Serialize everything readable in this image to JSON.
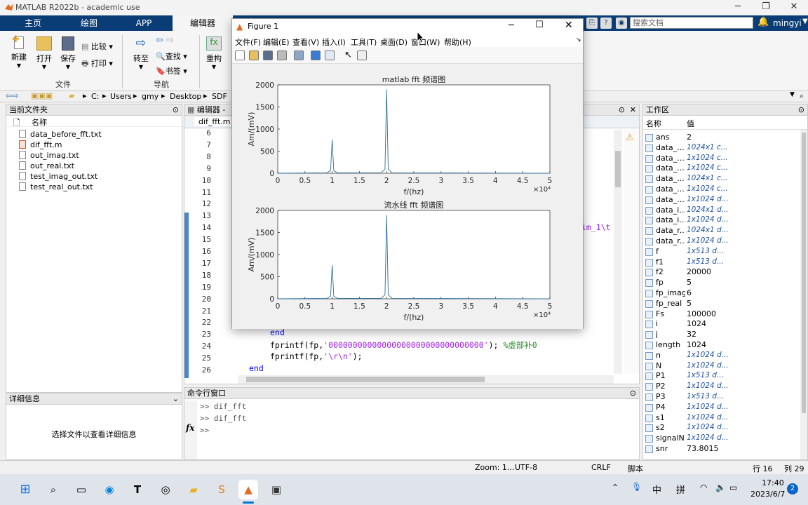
{
  "app": {
    "title": "MATLAB R2022b - academic use",
    "user": "mingyi",
    "search_placeholder": "搜索文档"
  },
  "tabs": [
    "主页",
    "绘图",
    "APP",
    "编辑器"
  ],
  "ribbon": {
    "buttons": {
      "new": "新建",
      "open": "打开",
      "save": "保存",
      "compare": "比较",
      "print": "打印",
      "goto": "转至",
      "find": "查找",
      "bookmark": "书签",
      "refactor": "重构"
    },
    "groups": {
      "file": "文件",
      "navigate": "导航"
    }
  },
  "path": [
    "C:",
    "Users",
    "gmy",
    "Desktop",
    "SDF"
  ],
  "files_panel": {
    "title": "当前文件夹",
    "col_name": "名称",
    "items": [
      "data_before_fft.txt",
      "dif_fft.m",
      "out_imag.txt",
      "out_real.txt",
      "test_imag_out.txt",
      "test_real_out.txt"
    ]
  },
  "details_panel": {
    "title": "详细信息",
    "message": "选择文件以查看详细信息"
  },
  "editor": {
    "title": "编辑器 - ",
    "tab": "dif_fft.m",
    "line_numbers": [
      "6",
      "7",
      "8",
      "9",
      "10",
      "11",
      "12",
      "13",
      "14",
      "15",
      "16",
      "17",
      "18",
      "19",
      "20",
      "21",
      "22",
      "23",
      "24",
      "25",
      "26"
    ],
    "code": {
      "l14_tail": "im_1\\t",
      "l23": "end",
      "l24_pre": "fprintf(fp,",
      "l24_str": "'00000000000000000000000000000000'",
      "l24_post": ");",
      "l24_comment": "%虚部补0",
      "l25_pre": "fprintf(fp,",
      "l25_str": "'\\r\\n'",
      "l25_post": ");",
      "l26": "end"
    }
  },
  "command_window": {
    "title": "命令行窗口",
    "lines": [
      ">> dif_fft",
      ">> dif_fft"
    ],
    "prompt": ">>"
  },
  "workspace": {
    "title": "工作区",
    "col_name": "名称",
    "col_value": "值",
    "rows": [
      {
        "name": "ans",
        "value": "2",
        "italic": false
      },
      {
        "name": "data_...",
        "value": "1024x1 c...",
        "italic": true
      },
      {
        "name": "data_...",
        "value": "1x1024 c...",
        "italic": true
      },
      {
        "name": "data_...",
        "value": "1x1024 c...",
        "italic": true
      },
      {
        "name": "data_...",
        "value": "1024x1 c...",
        "italic": true
      },
      {
        "name": "data_...",
        "value": "1x1024 c...",
        "italic": true
      },
      {
        "name": "data_...",
        "value": "1x1024 d...",
        "italic": true
      },
      {
        "name": "data_i...",
        "value": "1024x1 d...",
        "italic": true
      },
      {
        "name": "data_i...",
        "value": "1x1024 d...",
        "italic": true
      },
      {
        "name": "data_r...",
        "value": "1024x1 d...",
        "italic": true
      },
      {
        "name": "data_r...",
        "value": "1x1024 d...",
        "italic": true
      },
      {
        "name": "f",
        "value": "1x513 d...",
        "italic": true
      },
      {
        "name": "f1",
        "value": "1x513 d...",
        "italic": true
      },
      {
        "name": "f2",
        "value": "20000",
        "italic": false
      },
      {
        "name": "fp",
        "value": "5",
        "italic": false
      },
      {
        "name": "fp_imag",
        "value": "6",
        "italic": false
      },
      {
        "name": "fp_real",
        "value": "5",
        "italic": false
      },
      {
        "name": "Fs",
        "value": "100000",
        "italic": false
      },
      {
        "name": "i",
        "value": "1024",
        "italic": false
      },
      {
        "name": "j",
        "value": "32",
        "italic": false
      },
      {
        "name": "length",
        "value": "1024",
        "italic": false
      },
      {
        "name": "n",
        "value": "1x1024 d...",
        "italic": true
      },
      {
        "name": "N",
        "value": "1x1024 d...",
        "italic": true
      },
      {
        "name": "P1",
        "value": "1x513 d...",
        "italic": true
      },
      {
        "name": "P2",
        "value": "1x1024 d...",
        "italic": true
      },
      {
        "name": "P3",
        "value": "1x513 d...",
        "italic": true
      },
      {
        "name": "P4",
        "value": "1x1024 d...",
        "italic": true
      },
      {
        "name": "s1",
        "value": "1x1024 d...",
        "italic": true
      },
      {
        "name": "s2",
        "value": "1x1024 d...",
        "italic": true
      },
      {
        "name": "signalN",
        "value": "1x1024 d...",
        "italic": true
      },
      {
        "name": "snr",
        "value": "73.8015",
        "italic": false
      }
    ]
  },
  "statusbar": {
    "zoom": "Zoom: 1...",
    "encoding": "UTF-8",
    "eol": "CRLF",
    "mode": "脚本",
    "row": "行 16",
    "col": "列 29"
  },
  "figure": {
    "title": "Figure 1",
    "menu": [
      "文件(F)",
      "编辑(E)",
      "查看(V)",
      "插入(I)",
      "工具(T)",
      "桌面(D)",
      "窗口(W)",
      "帮助(H)"
    ]
  },
  "taskbar": {
    "time": "17:40",
    "date": "2023/6/7",
    "ime1": "中",
    "ime2": "拼",
    "notifications": "2"
  },
  "colors": {
    "tab_bar": "#0a3d75",
    "plot_line": "#2b6f9e",
    "accent": "#0078d4"
  },
  "chart_data": [
    {
      "type": "line",
      "title": "matlab fft 频谱图",
      "xlabel": "f/(hz)",
      "ylabel": "Am/(mV)",
      "x_exponent": "×10⁴",
      "xlim": [
        0,
        5
      ],
      "ylim": [
        0,
        2000
      ],
      "xticks": [
        "0",
        "0.5",
        "1",
        "1.5",
        "2",
        "2.5",
        "3",
        "3.5",
        "4",
        "4.5",
        "5"
      ],
      "yticks": [
        "0",
        "500",
        "1000",
        "1500",
        "2000"
      ],
      "series": [
        {
          "x": [
            0,
            0.9,
            0.97,
            1.0,
            1.03,
            1.1,
            1.9,
            1.97,
            2.0,
            2.03,
            2.1,
            5
          ],
          "y": [
            0,
            8,
            60,
            760,
            60,
            8,
            10,
            90,
            1890,
            90,
            10,
            0
          ]
        }
      ]
    },
    {
      "type": "line",
      "title": "流水线 fft 频谱图",
      "xlabel": "f/(hz)",
      "ylabel": "Am/(mV)",
      "x_exponent": "×10⁴",
      "xlim": [
        0,
        5
      ],
      "ylim": [
        0,
        2000
      ],
      "xticks": [
        "0",
        "0.5",
        "1",
        "1.5",
        "2",
        "2.5",
        "3",
        "3.5",
        "4",
        "4.5",
        "5"
      ],
      "yticks": [
        "0",
        "500",
        "1000",
        "1500",
        "2000"
      ],
      "series": [
        {
          "x": [
            0,
            0.9,
            0.97,
            1.0,
            1.03,
            1.1,
            1.9,
            1.97,
            2.0,
            2.03,
            2.1,
            5
          ],
          "y": [
            0,
            8,
            60,
            760,
            60,
            8,
            10,
            90,
            1890,
            90,
            10,
            0
          ]
        }
      ]
    }
  ]
}
